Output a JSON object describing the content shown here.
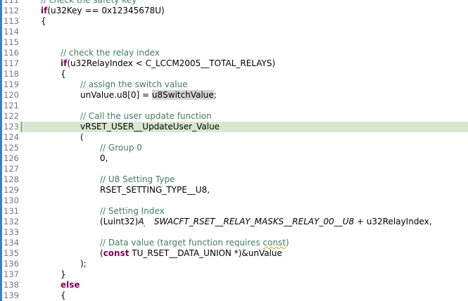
{
  "editor": {
    "lines": [
      {
        "num": "111",
        "indent": 1,
        "tokens": [
          {
            "t": "// check the safety key",
            "c": "comment"
          }
        ]
      },
      {
        "num": "112",
        "indent": 1,
        "tokens": [
          {
            "t": "if",
            "c": "kw"
          },
          {
            "t": "(u32Key == 0x12345678U)",
            "c": ""
          }
        ]
      },
      {
        "num": "113",
        "indent": 1,
        "tokens": [
          {
            "t": "{",
            "c": ""
          }
        ]
      },
      {
        "num": "114",
        "indent": 0,
        "tokens": []
      },
      {
        "num": "115",
        "indent": 0,
        "tokens": []
      },
      {
        "num": "116",
        "indent": 2,
        "tokens": [
          {
            "t": "// check the relay index",
            "c": "comment"
          }
        ]
      },
      {
        "num": "117",
        "indent": 2,
        "tokens": [
          {
            "t": "if",
            "c": "kw"
          },
          {
            "t": "(u32RelayIndex < C_LCCM2005__TOTAL_RELAYS)",
            "c": ""
          }
        ]
      },
      {
        "num": "118",
        "indent": 2,
        "tokens": [
          {
            "t": "{",
            "c": ""
          }
        ]
      },
      {
        "num": "119",
        "indent": 3,
        "tokens": [
          {
            "t": "// assign the switch value",
            "c": "comment"
          }
        ]
      },
      {
        "num": "120",
        "indent": 3,
        "tokens": [
          {
            "t": "unValue.u8[0] = ",
            "c": ""
          },
          {
            "t": "u8SwitchValue",
            "c": "mark"
          },
          {
            "t": ";",
            "c": ""
          }
        ]
      },
      {
        "num": "121",
        "indent": 0,
        "tokens": []
      },
      {
        "num": "122",
        "indent": 3,
        "tokens": [
          {
            "t": "// Call the user update function",
            "c": "comment"
          }
        ]
      },
      {
        "num": "123",
        "indent": 3,
        "tokens": [
          {
            "t": "vRSET_USER__UpdateUser_Value",
            "c": ""
          }
        ],
        "current": true
      },
      {
        "num": "124",
        "indent": 3,
        "tokens": [
          {
            "t": "(",
            "c": ""
          }
        ]
      },
      {
        "num": "125",
        "indent": 4,
        "tokens": [
          {
            "t": "// Group 0",
            "c": "comment"
          }
        ]
      },
      {
        "num": "126",
        "indent": 4,
        "tokens": [
          {
            "t": "0,",
            "c": ""
          }
        ]
      },
      {
        "num": "127",
        "indent": 0,
        "tokens": []
      },
      {
        "num": "128",
        "indent": 4,
        "tokens": [
          {
            "t": "// U8 Setting Type",
            "c": "comment"
          }
        ]
      },
      {
        "num": "129",
        "indent": 4,
        "tokens": [
          {
            "t": "RSET_SETTING_TYPE__U8,",
            "c": ""
          }
        ]
      },
      {
        "num": "130",
        "indent": 0,
        "tokens": []
      },
      {
        "num": "131",
        "indent": 4,
        "tokens": [
          {
            "t": "// Setting Index",
            "c": "comment"
          }
        ]
      },
      {
        "num": "132",
        "indent": 4,
        "tokens": [
          {
            "t": "(Luint32)",
            "c": ""
          },
          {
            "t": "A",
            "c": "macro"
          },
          {
            "t": "_RSWACFT_RSET__RELAY_MASKS__RELAY_00__U8",
            "c": "macro"
          },
          {
            "t": " + u32RelayIndex,",
            "c": ""
          }
        ]
      },
      {
        "num": "133",
        "indent": 0,
        "tokens": []
      },
      {
        "num": "134",
        "indent": 4,
        "tokens": [
          {
            "t": "// Data value (target function requires ",
            "c": "comment"
          },
          {
            "t": "const",
            "c": "comment squig"
          },
          {
            "t": ")",
            "c": "comment"
          }
        ]
      },
      {
        "num": "135",
        "indent": 4,
        "tokens": [
          {
            "t": "(",
            "c": ""
          },
          {
            "t": "const",
            "c": "kw"
          },
          {
            "t": " TU_RSET__DATA_UNION *)&unValue",
            "c": ""
          }
        ]
      },
      {
        "num": "136",
        "indent": 3,
        "tokens": [
          {
            "t": ");",
            "c": ""
          }
        ]
      },
      {
        "num": "137",
        "indent": 2,
        "tokens": [
          {
            "t": "}",
            "c": ""
          }
        ]
      },
      {
        "num": "138",
        "indent": 2,
        "tokens": [
          {
            "t": "else",
            "c": "kw"
          }
        ]
      },
      {
        "num": "139",
        "indent": 2,
        "tokens": [
          {
            "t": "{",
            "c": ""
          }
        ]
      }
    ]
  },
  "colors": {
    "comment": "#3f7f5f",
    "keyword": "#7f0055",
    "current_line": "#d8e8cf",
    "gutter_strip": "#3b7fbf"
  }
}
